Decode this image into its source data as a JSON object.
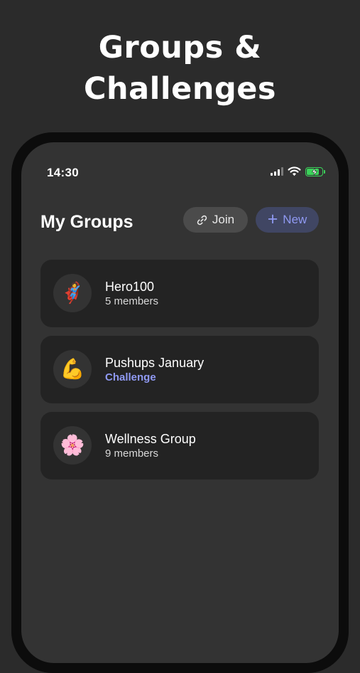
{
  "headline": {
    "line1": "Groups &",
    "line2": "Challenges"
  },
  "status_bar": {
    "time": "14:30"
  },
  "section": {
    "title": "My Groups",
    "join_label": "Join",
    "new_label": "New"
  },
  "groups": [
    {
      "name": "Hero100",
      "subtitle": "5 members",
      "avatar": "🦸"
    },
    {
      "name": "Pushups January",
      "subtitle": "Challenge",
      "avatar": "💪"
    },
    {
      "name": "Wellness Group",
      "subtitle": "9 members",
      "avatar": "🌸"
    }
  ],
  "colors": {
    "background": "#2b2b2b",
    "screen": "#333333",
    "card": "#232323",
    "accent": "#8f99f2",
    "battery": "#3bd35a"
  },
  "icons": [
    "signal-icon",
    "wifi-icon",
    "battery-charging-icon",
    "link-icon",
    "plus-icon"
  ],
  "battery_level": 0.85
}
